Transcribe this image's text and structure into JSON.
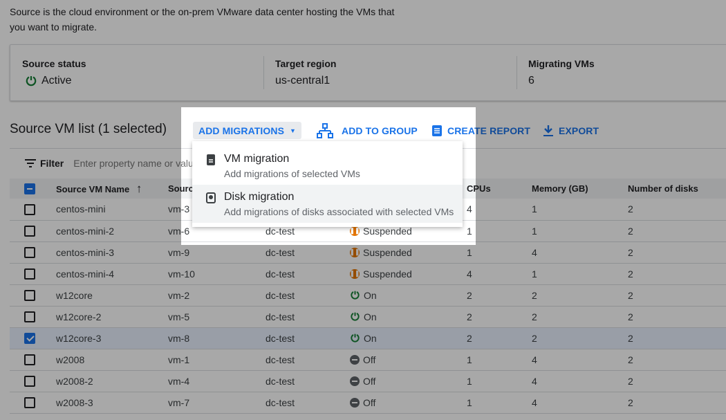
{
  "description": "Source is the cloud environment or the on-prem VMware data center hosting the VMs that you want to migrate.",
  "summary": {
    "source_status": {
      "label": "Source status",
      "value": "Active",
      "icon": "power-on-icon"
    },
    "target_region": {
      "label": "Target region",
      "value": "us-central1"
    },
    "migrating_vms": {
      "label": "Migrating VMs",
      "value": "6"
    }
  },
  "toolbar": {
    "title": "Source VM list (1 selected)",
    "add_migrations": "ADD MIGRATIONS",
    "add_to_group": "ADD TO GROUP",
    "create_report": "CREATE REPORT",
    "export": "EXPORT"
  },
  "filter": {
    "label": "Filter",
    "placeholder": "Enter property name or value"
  },
  "menu": [
    {
      "title": "VM migration",
      "subtitle": "Add migrations of selected VMs",
      "icon": "server-icon"
    },
    {
      "title": "Disk migration",
      "subtitle": "Add migrations of disks associated with selected VMs",
      "icon": "disk-icon"
    }
  ],
  "columns": [
    "Source VM Name",
    "Source",
    "",
    "",
    "CPUs",
    "Memory (GB)",
    "Number of disks"
  ],
  "rows": [
    {
      "name": "centos-mini",
      "id": "vm-3",
      "dc": "",
      "status": "",
      "cpus": "4",
      "mem": "1",
      "disks": "2",
      "selected": false
    },
    {
      "name": "centos-mini-2",
      "id": "vm-6",
      "dc": "dc-test",
      "status": "Suspended",
      "cpus": "1",
      "mem": "1",
      "disks": "2",
      "selected": false
    },
    {
      "name": "centos-mini-3",
      "id": "vm-9",
      "dc": "dc-test",
      "status": "Suspended",
      "cpus": "1",
      "mem": "4",
      "disks": "2",
      "selected": false
    },
    {
      "name": "centos-mini-4",
      "id": "vm-10",
      "dc": "dc-test",
      "status": "Suspended",
      "cpus": "4",
      "mem": "1",
      "disks": "2",
      "selected": false
    },
    {
      "name": "w12core",
      "id": "vm-2",
      "dc": "dc-test",
      "status": "On",
      "cpus": "2",
      "mem": "2",
      "disks": "2",
      "selected": false
    },
    {
      "name": "w12core-2",
      "id": "vm-5",
      "dc": "dc-test",
      "status": "On",
      "cpus": "2",
      "mem": "2",
      "disks": "2",
      "selected": false
    },
    {
      "name": "w12core-3",
      "id": "vm-8",
      "dc": "dc-test",
      "status": "On",
      "cpus": "2",
      "mem": "2",
      "disks": "2",
      "selected": true
    },
    {
      "name": "w2008",
      "id": "vm-1",
      "dc": "dc-test",
      "status": "Off",
      "cpus": "1",
      "mem": "4",
      "disks": "2",
      "selected": false
    },
    {
      "name": "w2008-2",
      "id": "vm-4",
      "dc": "dc-test",
      "status": "Off",
      "cpus": "1",
      "mem": "4",
      "disks": "2",
      "selected": false
    },
    {
      "name": "w2008-3",
      "id": "vm-7",
      "dc": "dc-test",
      "status": "Off",
      "cpus": "1",
      "mem": "4",
      "disks": "2",
      "selected": false
    }
  ],
  "colors": {
    "accent": "#1a73e8",
    "on": "#188038",
    "suspended": "#e37400",
    "off": "#5f6368"
  }
}
